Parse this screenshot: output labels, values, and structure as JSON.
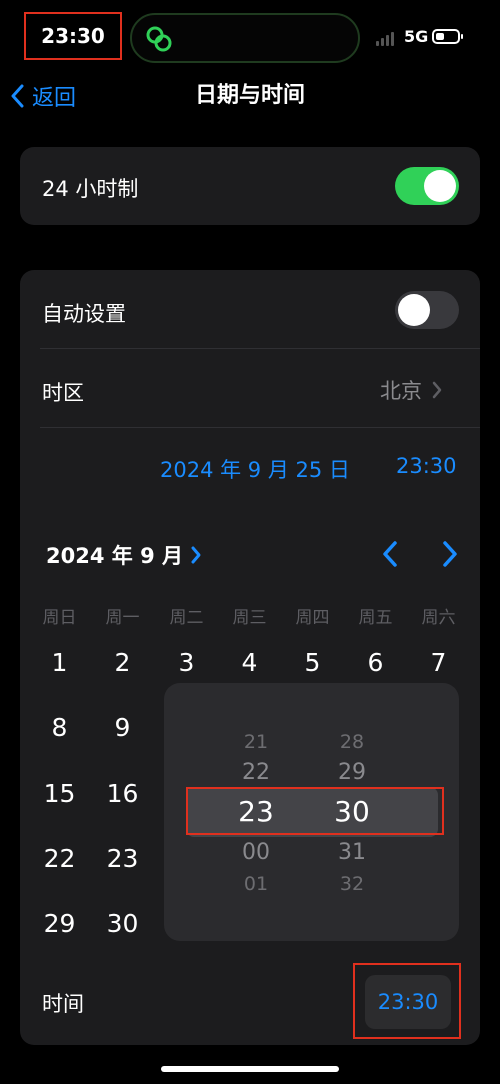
{
  "status": {
    "time": "23:30",
    "network": "5G"
  },
  "nav": {
    "back_label": "返回",
    "title": "日期与时间"
  },
  "h24": {
    "label": "24 小时制",
    "on": true
  },
  "auto": {
    "label": "自动设置",
    "on": false
  },
  "timezone": {
    "label": "时区",
    "value": "北京"
  },
  "selected": {
    "date": "2024 年 9 月 25 日",
    "time": "23:30"
  },
  "calendar": {
    "month_label": "2024 年 9 月",
    "weekdays": [
      "周日",
      "周一",
      "周二",
      "周三",
      "周四",
      "周五",
      "周六"
    ],
    "days": [
      "1",
      "2",
      "3",
      "4",
      "5",
      "6",
      "7",
      "8",
      "9",
      "15",
      "16",
      "22",
      "23",
      "29",
      "30"
    ]
  },
  "picker": {
    "hours": [
      "21",
      "22",
      "23",
      "00",
      "01"
    ],
    "minutes": [
      "28",
      "29",
      "30",
      "31",
      "32"
    ]
  },
  "time_row": {
    "label": "时间",
    "value": "23:30"
  },
  "colors": {
    "accent": "#1a8cff",
    "toggle_on": "#30d158",
    "highlight": "#e0301e"
  }
}
